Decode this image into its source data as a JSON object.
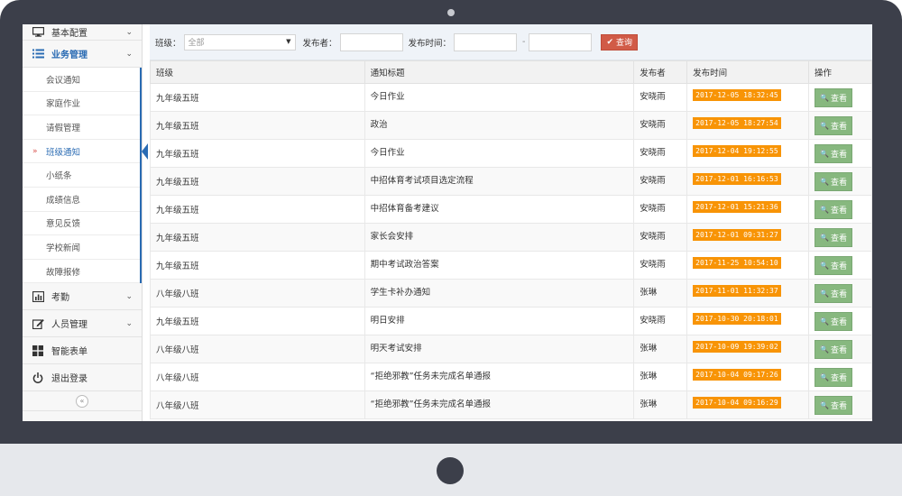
{
  "sidebar": {
    "top_item": {
      "label": "基本配置",
      "icon": "monitor-icon"
    },
    "groups_before": [
      {
        "label": "业务管理",
        "icon": "list-icon",
        "expanded": true
      }
    ],
    "sub_items": [
      {
        "label": "会议通知"
      },
      {
        "label": "家庭作业"
      },
      {
        "label": "请假管理"
      },
      {
        "label": "班级通知",
        "active": true
      },
      {
        "label": "小纸条"
      },
      {
        "label": "成绩信息"
      },
      {
        "label": "意见反馈"
      },
      {
        "label": "学校新闻"
      },
      {
        "label": "故障报修"
      }
    ],
    "groups_after": [
      {
        "label": "考勤",
        "icon": "chart-icon"
      },
      {
        "label": "人员管理",
        "icon": "edit-icon"
      },
      {
        "label": "智能表单",
        "icon": "grid-icon"
      },
      {
        "label": "退出登录",
        "icon": "power-icon"
      }
    ],
    "collapse_glyph": "«"
  },
  "filter": {
    "class_label": "班级：",
    "class_value": "全部",
    "publisher_label": "发布者：",
    "time_label": "发布时间：",
    "range_sep": "-",
    "query_label": "查询"
  },
  "table": {
    "columns": [
      "班级",
      "通知标题",
      "发布者",
      "发布时间",
      "操作"
    ],
    "view_label": "查看",
    "rows": [
      {
        "class": "九年级五班",
        "title": "今日作业",
        "publisher": "安晓雨",
        "time": "2017-12-05 18:32:45"
      },
      {
        "class": "九年级五班",
        "title": "政治",
        "publisher": "安晓雨",
        "time": "2017-12-05 18:27:54"
      },
      {
        "class": "九年级五班",
        "title": "今日作业",
        "publisher": "安晓雨",
        "time": "2017-12-04 19:12:55"
      },
      {
        "class": "九年级五班",
        "title": "中招体育考试项目选定流程",
        "publisher": "安晓雨",
        "time": "2017-12-01 16:16:53"
      },
      {
        "class": "九年级五班",
        "title": "中招体育备考建议",
        "publisher": "安晓雨",
        "time": "2017-12-01 15:21:36"
      },
      {
        "class": "九年级五班",
        "title": "家长会安排",
        "publisher": "安晓雨",
        "time": "2017-12-01 09:31:27"
      },
      {
        "class": "九年级五班",
        "title": "期中考试政治答案",
        "publisher": "安晓雨",
        "time": "2017-11-25 10:54:10"
      },
      {
        "class": "八年级八班",
        "title": "学生卡补办通知",
        "publisher": "张琳",
        "time": "2017-11-01 11:32:37"
      },
      {
        "class": "九年级五班",
        "title": "明日安排",
        "publisher": "安晓雨",
        "time": "2017-10-30 20:18:01"
      },
      {
        "class": "八年级八班",
        "title": "明天考试安排",
        "publisher": "张琳",
        "time": "2017-10-09 19:39:02"
      },
      {
        "class": "八年级八班",
        "title": "“拒绝邪教”任务未完成名单通报",
        "publisher": "张琳",
        "time": "2017-10-04 09:17:26"
      },
      {
        "class": "八年级八班",
        "title": "“拒绝邪教”任务未完成名单通报",
        "publisher": "张琳",
        "time": "2017-10-04 09:16:29"
      }
    ]
  },
  "colors": {
    "accent": "#2a6bb3",
    "time_badge": "#f89406",
    "view_button": "#87b87f",
    "query_button": "#d15b47",
    "frame": "#3c3f4a"
  }
}
